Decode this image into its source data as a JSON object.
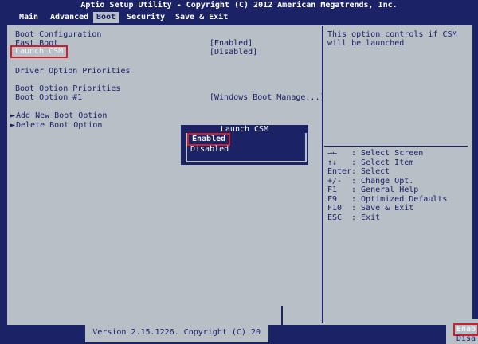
{
  "title": "Aptio Setup Utility - Copyright (C) 2012 American Megatrends, Inc.",
  "menu": [
    "Main",
    "Advanced",
    "Boot",
    "Security",
    "Save & Exit"
  ],
  "active_menu": "Boot",
  "left": {
    "boot_configuration": "Boot Configuration",
    "fast_boot_label": "Fast Boot",
    "fast_boot_value": "[Enabled]",
    "launch_csm_label": "Launch CSM",
    "launch_csm_value": "[Disabled]",
    "driver_option_priorities": "Driver Option Priorities",
    "boot_option_priorities": "Boot Option Priorities",
    "boot_option_1_label": "Boot Option #1",
    "boot_option_1_value": "[Windows Boot Manage...]",
    "add_new_boot_option": "Add New Boot Option",
    "delete_boot_option": "Delete Boot Option"
  },
  "help": {
    "line1": "This option controls if CSM",
    "line2": "will be launched"
  },
  "keys": [
    {
      "key": "→←",
      "action": ": Select Screen"
    },
    {
      "key": "↑↓",
      "action": ": Select Item"
    },
    {
      "key": "Enter",
      "action": ": Select"
    },
    {
      "key": "+/-",
      "action": ": Change Opt."
    },
    {
      "key": "F1",
      "action": ": General Help"
    },
    {
      "key": "F9",
      "action": ": Optimized Defaults"
    },
    {
      "key": "F10",
      "action": ": Save & Exit"
    },
    {
      "key": "ESC",
      "action": ": Exit"
    }
  ],
  "popup": {
    "title": "Launch CSM",
    "options": [
      "Enabled",
      "Disabled"
    ],
    "selected": "Enabled"
  },
  "version": "Version 2.15.1226. Copyright (C) 20",
  "corner_text": [
    "Enab",
    "Disa"
  ]
}
